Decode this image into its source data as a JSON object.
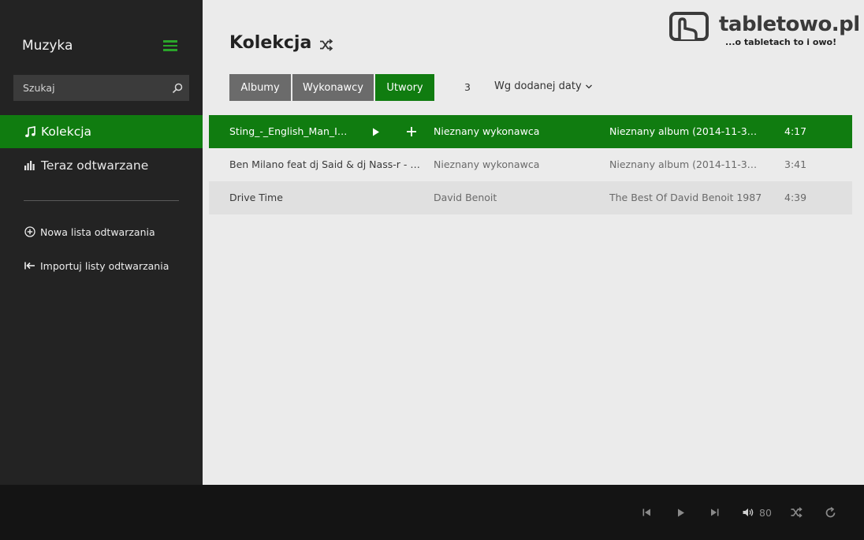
{
  "sidebar": {
    "app_title": "Muzyka",
    "search": {
      "placeholder": "Szukaj",
      "value": ""
    },
    "nav": [
      {
        "label": "Kolekcja",
        "icon": "music-note-icon",
        "active": true
      },
      {
        "label": "Teraz odtwarzane",
        "icon": "equalizer-icon",
        "active": false
      }
    ],
    "playlist_actions": [
      {
        "label": "Nowa lista odtwarzania",
        "icon": "add-circle-icon"
      },
      {
        "label": "Importuj listy odtwarzania",
        "icon": "import-icon"
      }
    ]
  },
  "main": {
    "title": "Kolekcja",
    "tabs": [
      {
        "label": "Albumy",
        "active": false
      },
      {
        "label": "Wykonawcy",
        "active": false
      },
      {
        "label": "Utwory",
        "active": true
      }
    ],
    "count": "3",
    "sort_label": "Wg dodanej daty",
    "tracks": [
      {
        "title": "Sting_-_English_Man_In_...",
        "artist": "Nieznany wykonawca",
        "album": "Nieznany album (2014-11-30 15...",
        "duration": "4:17",
        "selected": true
      },
      {
        "title": "Ben Milano feat dj Said & dj Nass-r - im...",
        "artist": "Nieznany wykonawca",
        "album": "Nieznany album (2014-11-30 15...",
        "duration": "3:41",
        "selected": false
      },
      {
        "title": "Drive Time",
        "artist": "David Benoit",
        "album": "The Best Of David Benoit 1987",
        "duration": "4:39",
        "selected": false
      }
    ]
  },
  "logo": {
    "name": "tabletowo.pl",
    "tagline": "...o tabletach to i owo!"
  },
  "player": {
    "volume": "80"
  },
  "colors": {
    "accent": "#107c10",
    "sidebar_bg": "#232323",
    "content_bg": "#ebebeb",
    "player_bg": "#141414"
  }
}
